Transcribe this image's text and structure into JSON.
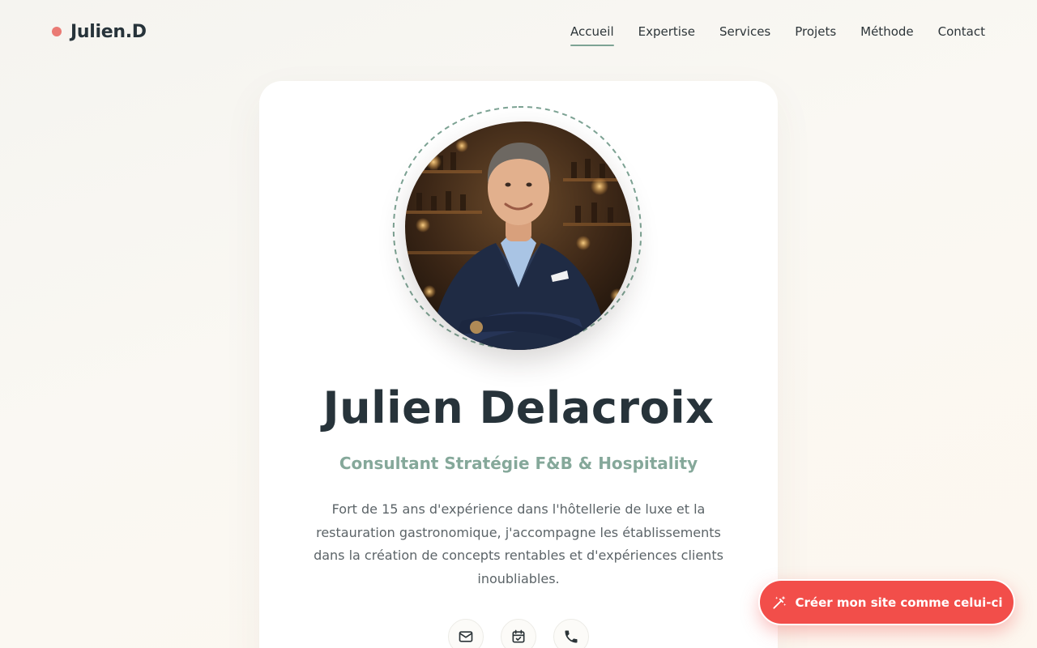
{
  "brand": {
    "name": "Julien.D",
    "dot_color": "#ea7a74"
  },
  "nav": {
    "items": [
      {
        "label": "Accueil",
        "active": true
      },
      {
        "label": "Expertise",
        "active": false
      },
      {
        "label": "Services",
        "active": false
      },
      {
        "label": "Projets",
        "active": false
      },
      {
        "label": "Méthode",
        "active": false
      },
      {
        "label": "Contact",
        "active": false
      }
    ],
    "active_underline_color": "#7da394"
  },
  "profile": {
    "photo_icon": "portrait-photo",
    "name": "Julien Delacroix",
    "role": "Consultant Stratégie F&B & Hospitality",
    "bio": "Fort de 15 ans d'expérience dans l'hôtellerie de luxe et la restauration gastronomique, j'accompagne les établissements dans la création de concepts rentables et d'expériences clients inoubliables.",
    "contact_icons": [
      "mail-icon",
      "calendar-check-icon",
      "phone-icon"
    ]
  },
  "cta": {
    "label": "Créer mon site comme celui-ci",
    "icon": "magic-wand-icon",
    "color": "#f24e4a"
  },
  "colors": {
    "accent_green": "#85a89a",
    "heading": "#27333a",
    "body_text": "#5c6468"
  }
}
